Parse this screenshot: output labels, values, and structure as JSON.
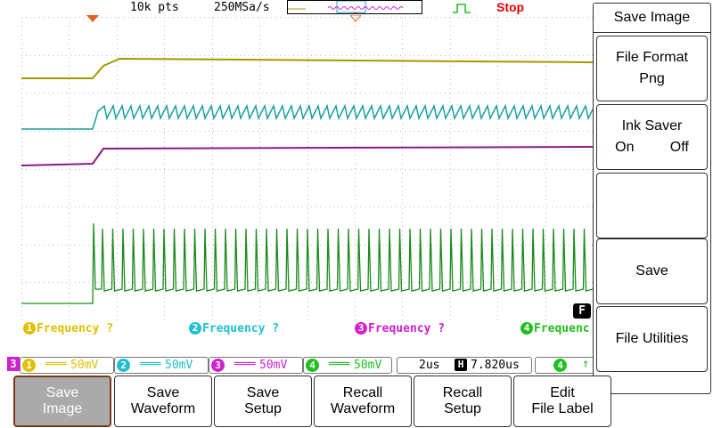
{
  "header": {
    "points": "10k pts",
    "sample_rate": "250MSa/s",
    "run_state": "Stop"
  },
  "colors": {
    "ch1": "#a39a00",
    "ch2": "#1a9fa0",
    "ch3": "#8a1a8a",
    "ch4": "#1a8a1a",
    "ch1_text": "#e0c000",
    "ch2_text": "#20c0d0",
    "ch3_text": "#d020d0",
    "ch4_text": "#20c020",
    "stop": "#e00000",
    "trigger_marker": "#e06020"
  },
  "measurements": [
    {
      "num": "1",
      "label": "Frequency ?"
    },
    {
      "num": "2",
      "label": "Frequency ?"
    },
    {
      "num": "3",
      "label": "Frequency ?"
    },
    {
      "num": "4",
      "label": "Frequenc"
    }
  ],
  "channels": [
    {
      "num": "1",
      "coupling": "DC",
      "scale": "50mV"
    },
    {
      "num": "2",
      "coupling": "DC",
      "scale": "50mV"
    },
    {
      "num": "3",
      "coupling": "DC",
      "scale": "50mV"
    },
    {
      "num": "4",
      "coupling": "DC",
      "scale": "50mV"
    }
  ],
  "status": {
    "selected_channel": "3",
    "timebase": "2us",
    "h_marker": "H",
    "h_delay": "7.820us",
    "trigger_channel": "4",
    "f_marker": "F"
  },
  "menu": {
    "title": "Save Image",
    "file_format_label": "File Format",
    "file_format_value": "Png",
    "ink_saver_label": "Ink Saver",
    "ink_saver_on": "On",
    "ink_saver_off": "Off",
    "save_label": "Save",
    "file_utilities_label": "File Utilities"
  },
  "softkeys": [
    {
      "line1": "Save",
      "line2": "Image"
    },
    {
      "line1": "Save",
      "line2": "Waveform"
    },
    {
      "line1": "Save",
      "line2": "Setup"
    },
    {
      "line1": "Recall",
      "line2": "Waveform"
    },
    {
      "line1": "Recall",
      "line2": "Setup"
    },
    {
      "line1": "Edit",
      "line2": "File Label"
    }
  ]
}
